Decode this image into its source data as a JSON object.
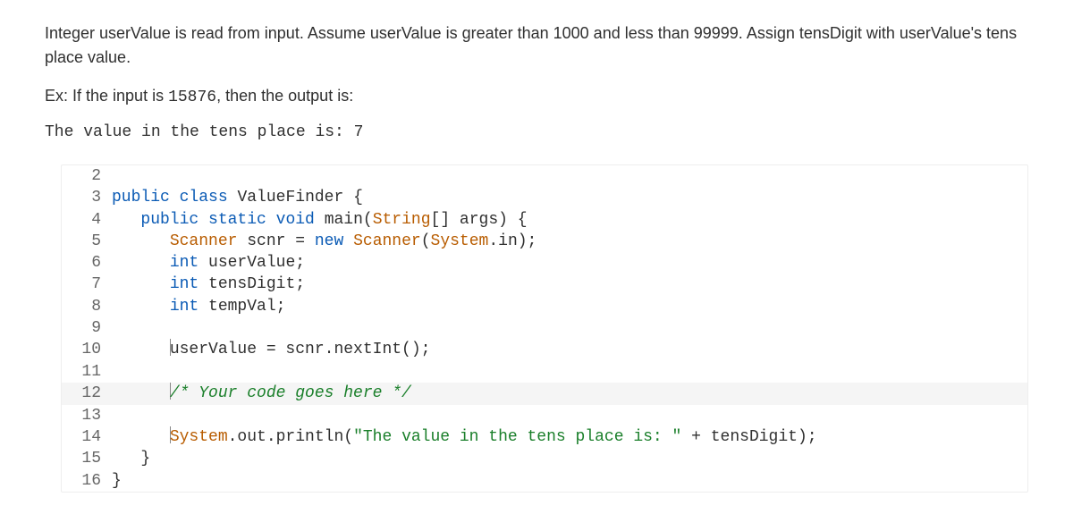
{
  "problem": {
    "description": "Integer userValue is read from input. Assume userValue is greater than 1000 and less than 99999. Assign tensDigit with userValue's tens place value.",
    "example_prefix": "Ex: If the input is ",
    "example_input": "15876",
    "example_suffix": ", then the output is:",
    "example_output": "The value in the tens place is: 7"
  },
  "code": {
    "lines": {
      "l2": "",
      "l3a": "public",
      "l3b": "class",
      "l3c": "ValueFinder",
      "l3d": "{",
      "l4a": "public",
      "l4b": "static",
      "l4c": "void",
      "l4d": "main(",
      "l4e": "String",
      "l4f": "[] args) {",
      "l5a": "Scanner",
      "l5b": "scnr = ",
      "l5c": "new",
      "l5d": "Scanner",
      "l5e": "(",
      "l5f": "System",
      "l5g": ".in);",
      "l6a": "int",
      "l6b": "userValue;",
      "l7a": "int",
      "l7b": "tensDigit;",
      "l8a": "int",
      "l8b": "tempVal;",
      "l10": "userValue = scnr.nextInt();",
      "l12": "/* Your code goes here */",
      "l14a": "System",
      "l14b": ".out.println(",
      "l14c": "\"The value in the tens place is: \"",
      "l14d": " + tensDigit);",
      "l15": "}",
      "l16": "}"
    },
    "gutters": {
      "g2": "2",
      "g3": "3",
      "g4": "4",
      "g5": "5",
      "g6": "6",
      "g7": "7",
      "g8": "8",
      "g9": "9",
      "g10": "10",
      "g11": "11",
      "g12": "12",
      "g13": "13",
      "g14": "14",
      "g15": "15",
      "g16": "16"
    }
  }
}
